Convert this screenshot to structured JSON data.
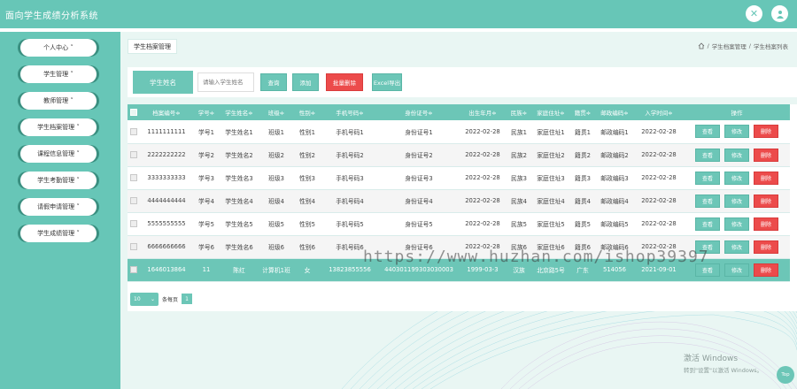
{
  "app": {
    "title": "面向学生成绩分析系统"
  },
  "header": {
    "icons": [
      "close-icon",
      "user-icon"
    ]
  },
  "sidebar": {
    "items": [
      {
        "label": "个人中心 ˅"
      },
      {
        "label": "学生管理 ˅"
      },
      {
        "label": "教师管理 ˅"
      },
      {
        "label": "学生档案管理 ˅"
      },
      {
        "label": "课程信息管理 ˅"
      },
      {
        "label": "学生考勤管理 ˅"
      },
      {
        "label": "请假申请管理 ˅"
      },
      {
        "label": "学生成绩管理 ˅"
      }
    ]
  },
  "breadcrumb": {
    "tab": "学生档案管理",
    "home_icon": "home-icon",
    "path": [
      "学生档案管理",
      "学生档案列表"
    ],
    "separator": "/"
  },
  "search": {
    "label": "学生姓名",
    "placeholder": "请输入学生姓名",
    "query_btn": "查询",
    "add_btn": "添加",
    "batch_delete_btn": "批量删除",
    "export_btn": "Excel导出"
  },
  "table": {
    "columns": [
      "档案编号≑",
      "学号≑",
      "学生姓名≑",
      "班级≑",
      "性别≑",
      "手机号码≑",
      "身份证号≑",
      "出生年月≑",
      "民族≑",
      "家庭住址≑",
      "籍贯≑",
      "邮政编码≑",
      "入学时间≑",
      "操作"
    ],
    "actions": {
      "view": "查看",
      "edit": "修改",
      "delete": "删除"
    },
    "rows": [
      [
        "1111111111",
        "学号1",
        "学生姓名1",
        "班级1",
        "性别1",
        "手机号码1",
        "身份证号1",
        "2022-02-28",
        "民族1",
        "家庭住址1",
        "籍贯1",
        "邮政编码1",
        "2022-02-28"
      ],
      [
        "2222222222",
        "学号2",
        "学生姓名2",
        "班级2",
        "性别2",
        "手机号码2",
        "身份证号2",
        "2022-02-28",
        "民族2",
        "家庭住址2",
        "籍贯2",
        "邮政编码2",
        "2022-02-28"
      ],
      [
        "3333333333",
        "学号3",
        "学生姓名3",
        "班级3",
        "性别3",
        "手机号码3",
        "身份证号3",
        "2022-02-28",
        "民族3",
        "家庭住址3",
        "籍贯3",
        "邮政编码3",
        "2022-02-28"
      ],
      [
        "4444444444",
        "学号4",
        "学生姓名4",
        "班级4",
        "性别4",
        "手机号码4",
        "身份证号4",
        "2022-02-28",
        "民族4",
        "家庭住址4",
        "籍贯4",
        "邮政编码4",
        "2022-02-28"
      ],
      [
        "5555555555",
        "学号5",
        "学生姓名5",
        "班级5",
        "性别5",
        "手机号码5",
        "身份证号5",
        "2022-02-28",
        "民族5",
        "家庭住址5",
        "籍贯5",
        "邮政编码5",
        "2022-02-28"
      ],
      [
        "6666666666",
        "学号6",
        "学生姓名6",
        "班级6",
        "性别6",
        "手机号码6",
        "身份证号6",
        "2022-02-28",
        "民族6",
        "家庭住址6",
        "籍贯6",
        "邮政编码6",
        "2022-02-28"
      ],
      [
        "1646013864",
        "11",
        "陈红",
        "计算机1班",
        "女",
        "13823855556",
        "440301199303030003",
        "1999-03-3",
        "汉族",
        "北京路5号",
        "广东",
        "514056",
        "2021-09-01"
      ]
    ],
    "highlight_row": 6
  },
  "pager": {
    "page_size": "10",
    "per_page_label": "条每页",
    "current_page": "1"
  },
  "watermark": "https://www.huzhan.com/ishop39397",
  "windows_activation": {
    "line1": "激活 Windows",
    "line2": "转到\"设置\"以激活 Windows。"
  },
  "back_to_top": "Top",
  "colors": {
    "primary": "#67c6b7",
    "danger": "#ec4b4b",
    "background": "#e9f6f3"
  }
}
